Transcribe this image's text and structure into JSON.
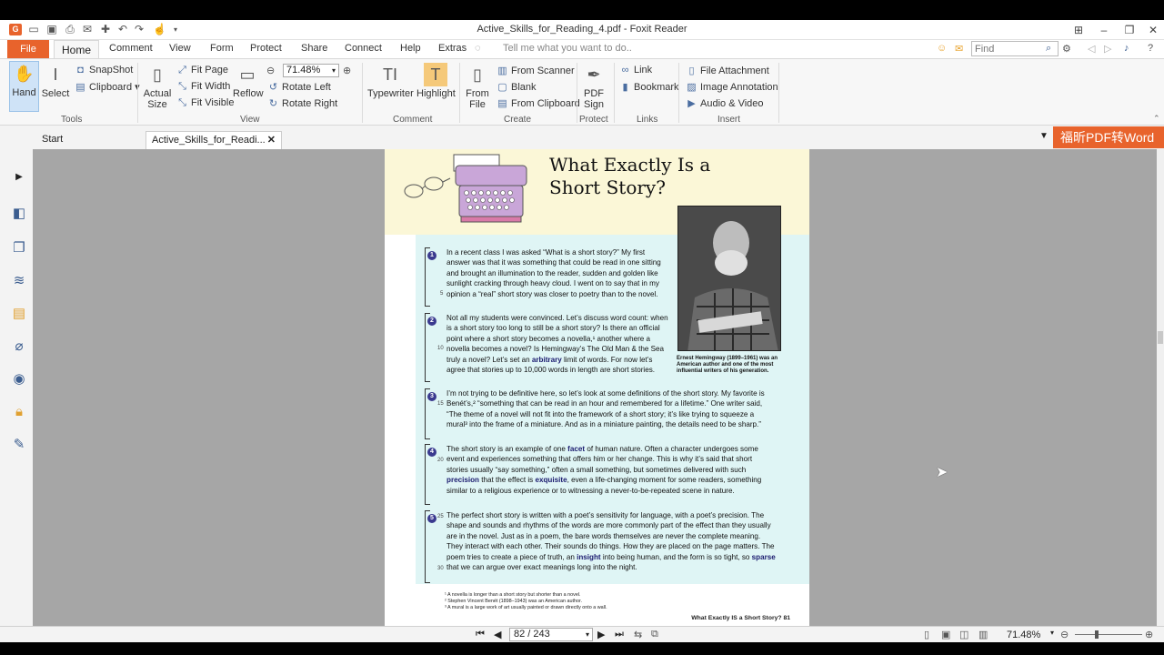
{
  "window": {
    "title": "Active_Skills_for_Reading_4.pdf - Foxit Reader"
  },
  "menu": {
    "file": "File",
    "items": [
      "Home",
      "Comment",
      "View",
      "Form",
      "Protect",
      "Share",
      "Connect",
      "Help",
      "Extras"
    ],
    "tell_me": "Tell me what you want to do..",
    "find_placeholder": "Find"
  },
  "ribbon": {
    "hand": "Hand",
    "select": "Select",
    "snapshot": "SnapShot",
    "clipboard": "Clipboard",
    "actual_size_1": "Actual",
    "actual_size_2": "Size",
    "fit_page": "Fit Page",
    "fit_width": "Fit Width",
    "fit_visible": "Fit Visible",
    "reflow": "Reflow",
    "zoom": "71.48%",
    "rotate_left": "Rotate Left",
    "rotate_right": "Rotate Right",
    "typewriter": "Typewriter",
    "highlight": "Highlight",
    "from_file_1": "From",
    "from_file_2": "File",
    "from_scanner": "From Scanner",
    "blank": "Blank",
    "from_clipboard": "From Clipboard",
    "pdf_sign_1": "PDF",
    "pdf_sign_2": "Sign",
    "link": "Link",
    "bookmark": "Bookmark",
    "file_attachment": "File Attachment",
    "image_annotation": "Image Annotation",
    "audio_video": "Audio & Video",
    "groups": {
      "tools": "Tools",
      "view": "View",
      "comment": "Comment",
      "create": "Create",
      "protect": "Protect",
      "links": "Links",
      "insert": "Insert"
    }
  },
  "tabs": {
    "start": "Start",
    "doc": "Active_Skills_for_Readi..."
  },
  "promo": "福昕PDF转Word",
  "page": {
    "title_1": "What Exactly Is a",
    "title_2": "Short Story?",
    "photo_caption": "Ernest Hemingway (1899–1961) was an American author and one of the most influential writers of his generation.",
    "p1": "In a recent class I was asked “What is a short story?” My first answer was that it was something that could be read in one sitting and brought an illumination to the reader, sudden and golden like sunlight cracking through heavy cloud. I went on to say that in my opinion a “real” short story was closer to poetry than to the novel.",
    "p2a": "Not all my students were convinced. Let’s discuss word count: when is a short story too long to still be a short story? Is there an official point where a short story becomes a novella,¹ another where a novella becomes a novel? Is Hemingway’s The Old Man & the Sea truly a novel? Let’s set an ",
    "p2_bold": "arbitrary",
    "p2b": " limit of words. For now let’s agree that stories up to 10,000 words in length are short stories.",
    "p3": "I’m not trying to be definitive here, so let’s look at some definitions of the short story. My favorite is Benét’s,² “something that can be read in an hour and remembered for a lifetime.” One writer said, “The theme of a novel will not fit into the framework of a short story; it’s like trying to squeeze a mural³ into the frame of a miniature. And as in a miniature painting, the details need to be sharp.”",
    "p4a": "The short story is an example of one ",
    "p4_bold1": "facet",
    "p4b": " of human nature. Often a character undergoes some event and experiences something that offers him or her change. This is why it’s said that short stories usually “say something,” often a small something, but sometimes delivered with such ",
    "p4_bold2": "precision",
    "p4c": " that the effect is ",
    "p4_bold3": "exquisite",
    "p4d": ", even a life-changing moment for some readers, something similar to a religious experience or to witnessing a never-to-be-repeated scene in nature.",
    "p5a": "The perfect short story is written with a poet’s sensitivity for language, with a poet’s precision. The shape and sounds and rhythms of the words are more commonly part of the effect than they usually are in the novel. Just as in a poem, the bare words themselves are never the complete meaning. They interact with each other. Their sounds do things. How they are placed on the page matters. The poem tries to create a piece of truth, an ",
    "p5_bold1": "insight",
    "p5b": " into being human, and the form is so tight, so ",
    "p5_bold2": "sparse",
    "p5c": " that we can argue over exact meanings long into the night.",
    "fn1": "¹ A novella is longer than a short story but shorter than a novel.",
    "fn2": "² Stephen Vincent Benét (1898–1943) was an American author.",
    "fn3": "³ A mural is a large work of art usually painted or drawn directly onto a wall.",
    "footer": "What Exactly IS a Short Story?   81",
    "para_numbers": [
      "1",
      "2",
      "3",
      "4",
      "5"
    ],
    "line_numbers": [
      "5",
      "10",
      "15",
      "20",
      "25",
      "30"
    ]
  },
  "status": {
    "page": "82 / 243",
    "zoom": "71.48%"
  }
}
